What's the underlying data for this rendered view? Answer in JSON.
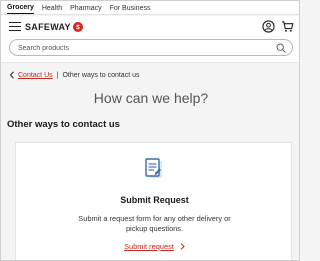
{
  "tabs": [
    {
      "label": "Grocery"
    },
    {
      "label": "Health"
    },
    {
      "label": "Pharmacy"
    },
    {
      "label": "For Business"
    }
  ],
  "header": {
    "logo_text": "SAFEWAY",
    "brand_color": "#d7261e"
  },
  "search": {
    "placeholder": "Search products",
    "value": ""
  },
  "breadcrumb": {
    "link_label": "Contact Us",
    "separator": "|",
    "current": "Other ways to contact us"
  },
  "main": {
    "title": "How can we help?",
    "section_title": "Other ways to contact us"
  },
  "card": {
    "icon": "document-icon",
    "title": "Submit Request",
    "description": "Submit a request form for any other delivery or pickup questions.",
    "link_label": "Submit request",
    "accent_color": "#c1281f"
  }
}
